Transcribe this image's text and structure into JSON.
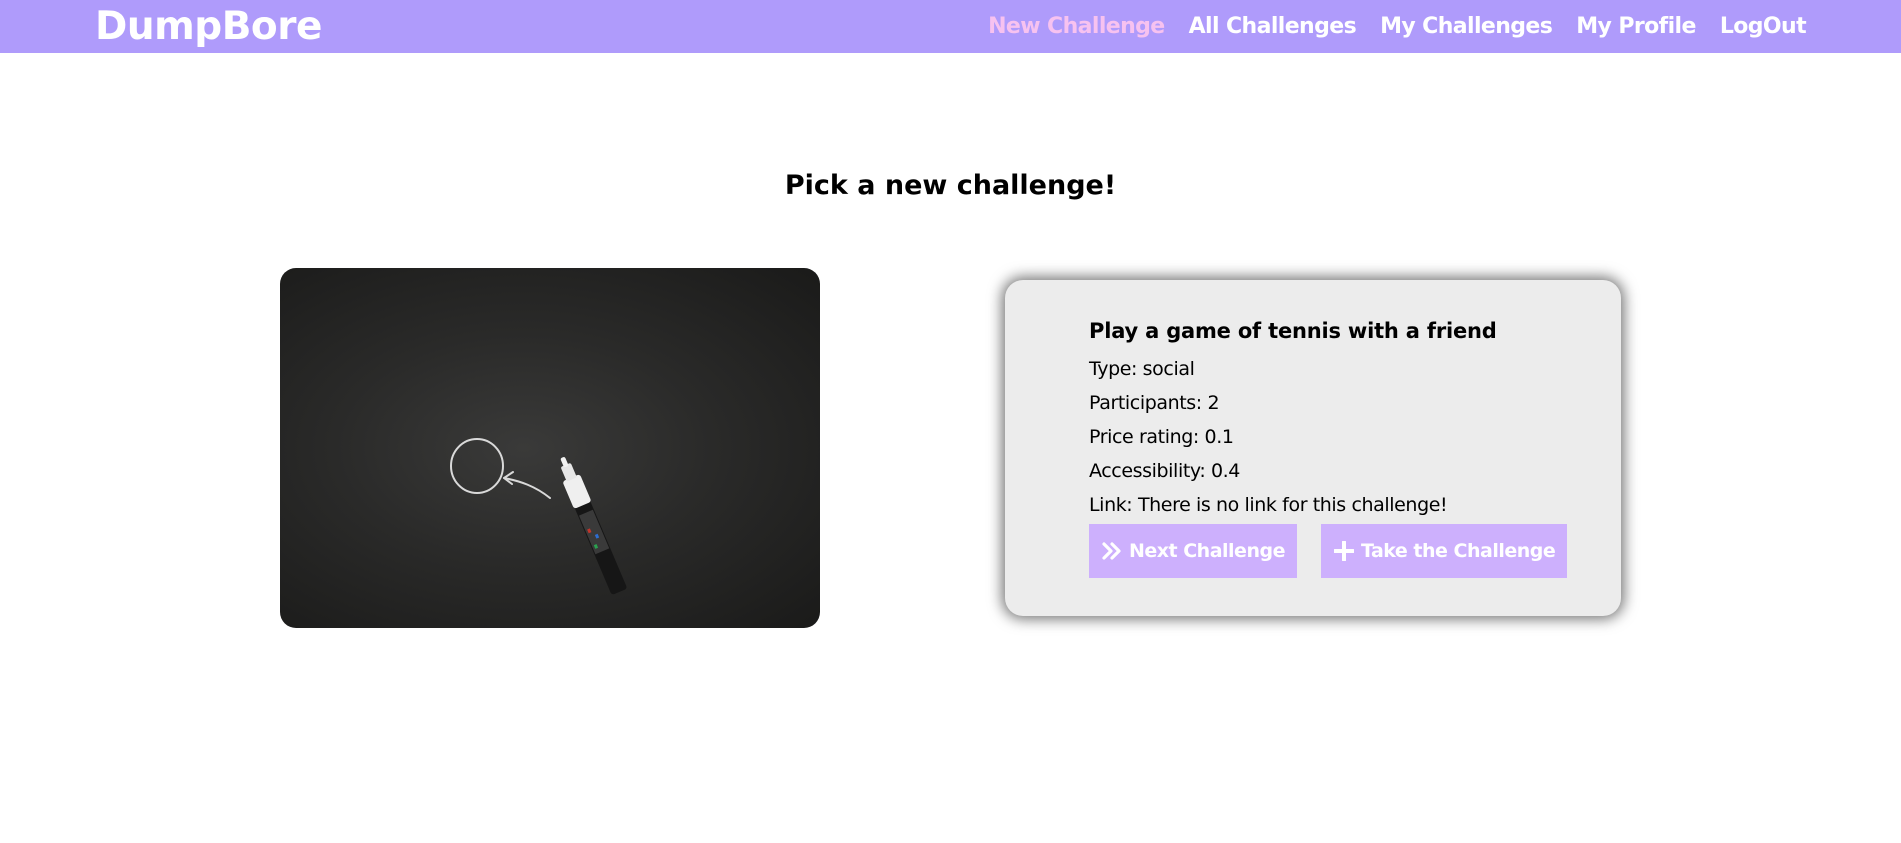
{
  "brand": {
    "name": "DumpBore"
  },
  "nav": {
    "links": [
      {
        "label": "New Challenge",
        "active": true
      },
      {
        "label": "All Challenges",
        "active": false
      },
      {
        "label": "My Challenges",
        "active": false
      },
      {
        "label": "My Profile",
        "active": false
      },
      {
        "label": "LogOut",
        "active": false
      }
    ]
  },
  "page": {
    "title": "Pick a new challenge!"
  },
  "challenge": {
    "title": "Play a game of tennis with a friend",
    "type": "Type: social",
    "participants": "Participants: 2",
    "price": "Price rating: 0.1",
    "accessibility": "Accessibility: 0.4",
    "link": "Link: There is no link for this challenge!"
  },
  "buttons": {
    "next": {
      "label": "Next Challenge",
      "icon": "double-chevron-right-icon"
    },
    "take": {
      "label": "Take the Challenge",
      "icon": "plus-icon"
    }
  },
  "colors": {
    "navbar": "#af9bfb",
    "nav_active": "#f7c2f0",
    "button": "#cdb0fd",
    "card": "#ececec"
  }
}
